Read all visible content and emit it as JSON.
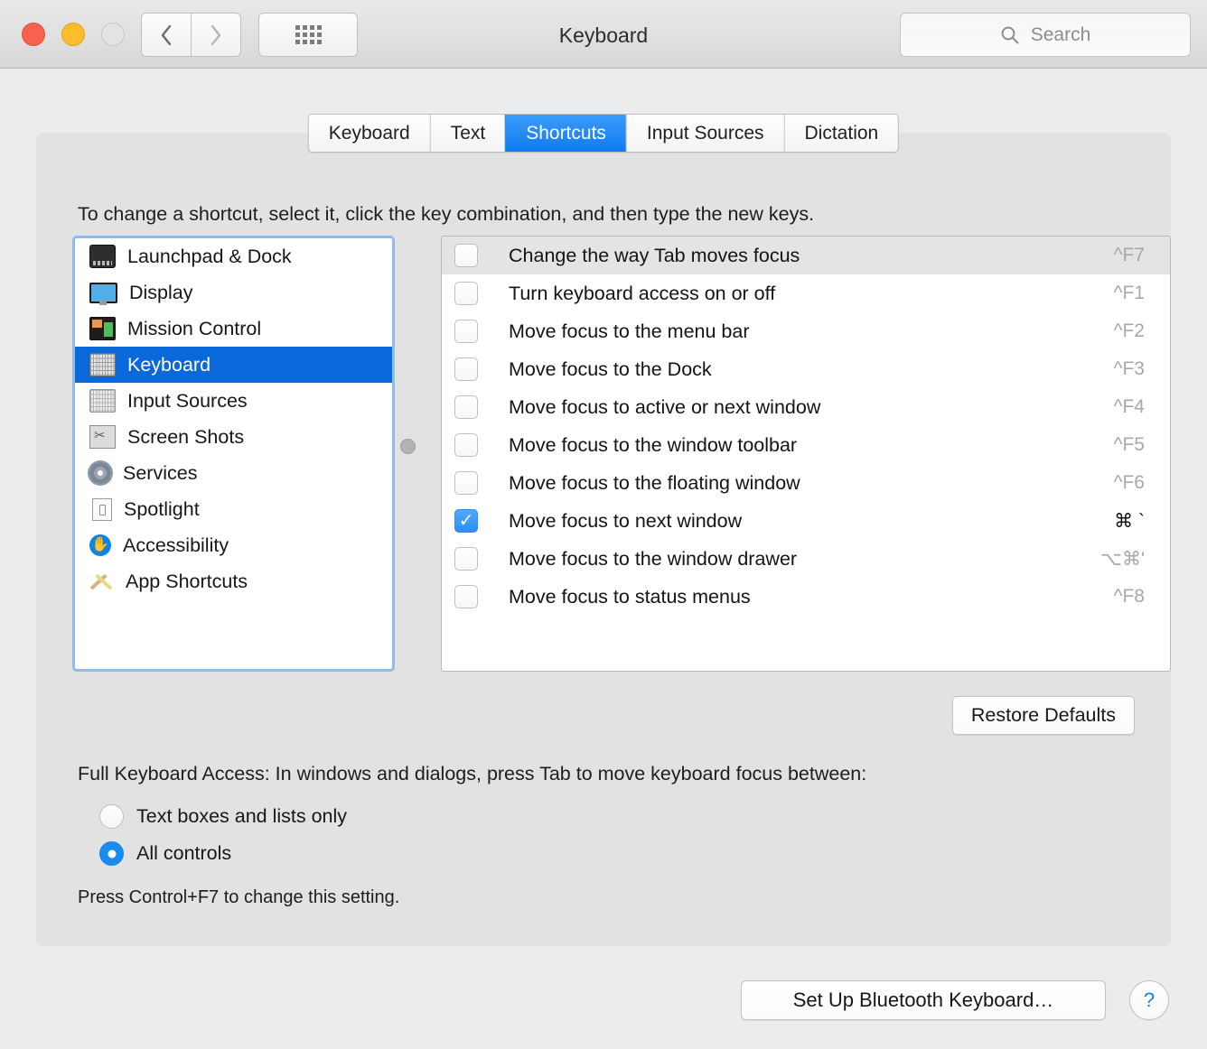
{
  "window": {
    "title": "Keyboard",
    "traffic_lights": [
      "close-red",
      "minimize-yellow",
      "zoom-gray"
    ],
    "back_glyph": "‹",
    "forward_glyph": "›",
    "grid_icon": "show-all-grid-icon"
  },
  "search": {
    "placeholder": "Search",
    "icon": "search-icon"
  },
  "tabs": [
    {
      "label": "Keyboard",
      "active": false
    },
    {
      "label": "Text",
      "active": false
    },
    {
      "label": "Shortcuts",
      "active": true
    },
    {
      "label": "Input Sources",
      "active": false
    },
    {
      "label": "Dictation",
      "active": false
    }
  ],
  "hint": "To change a shortcut, select it, click the key combination, and then type the new keys.",
  "sidebar": {
    "items": [
      {
        "label": "Launchpad & Dock",
        "icon": "launchpad-dock-icon",
        "selected": false
      },
      {
        "label": "Display",
        "icon": "display-icon",
        "selected": false
      },
      {
        "label": "Mission Control",
        "icon": "mission-control-icon",
        "selected": false
      },
      {
        "label": "Keyboard",
        "icon": "keyboard-icon",
        "selected": true
      },
      {
        "label": "Input Sources",
        "icon": "input-sources-icon",
        "selected": false
      },
      {
        "label": "Screen Shots",
        "icon": "screen-shots-icon",
        "selected": false
      },
      {
        "label": "Services",
        "icon": "services-gear-icon",
        "selected": false
      },
      {
        "label": "Spotlight",
        "icon": "spotlight-icon",
        "selected": false
      },
      {
        "label": "Accessibility",
        "icon": "accessibility-icon",
        "selected": false
      },
      {
        "label": "App Shortcuts",
        "icon": "app-shortcuts-icon",
        "selected": false
      }
    ]
  },
  "shortcuts": [
    {
      "label": "Change the way Tab moves focus",
      "combo": "^F7",
      "checked": false,
      "selected": true
    },
    {
      "label": "Turn keyboard access on or off",
      "combo": "^F1",
      "checked": false,
      "selected": false
    },
    {
      "label": "Move focus to the menu bar",
      "combo": "^F2",
      "checked": false,
      "selected": false
    },
    {
      "label": "Move focus to the Dock",
      "combo": "^F3",
      "checked": false,
      "selected": false
    },
    {
      "label": "Move focus to active or next window",
      "combo": "^F4",
      "checked": false,
      "selected": false
    },
    {
      "label": "Move focus to the window toolbar",
      "combo": "^F5",
      "checked": false,
      "selected": false
    },
    {
      "label": "Move focus to the floating window",
      "combo": "^F6",
      "checked": false,
      "selected": false
    },
    {
      "label": "Move focus to next window",
      "combo": "⌘ `",
      "checked": true,
      "selected": false
    },
    {
      "label": "Move focus to the window drawer",
      "combo": "⌥⌘'",
      "checked": false,
      "selected": false
    },
    {
      "label": "Move focus to status menus",
      "combo": "^F8",
      "checked": false,
      "selected": false
    }
  ],
  "checkmark_glyph": "✓",
  "buttons": {
    "restore_defaults": "Restore Defaults",
    "set_up_bluetooth_keyboard": "Set Up Bluetooth Keyboard…",
    "help": "?"
  },
  "full_keyboard_access": {
    "title": "Full Keyboard Access: In windows and dialogs, press Tab to move keyboard focus between:",
    "options": [
      {
        "label": "Text boxes and lists only",
        "selected": false
      },
      {
        "label": "All controls",
        "selected": true
      }
    ],
    "note": "Press Control+F7 to change this setting."
  },
  "colors": {
    "accent_blue": "#0a69da",
    "tab_active": "#1e8bf5",
    "sidebar_focus_ring": "#8fbcea"
  }
}
